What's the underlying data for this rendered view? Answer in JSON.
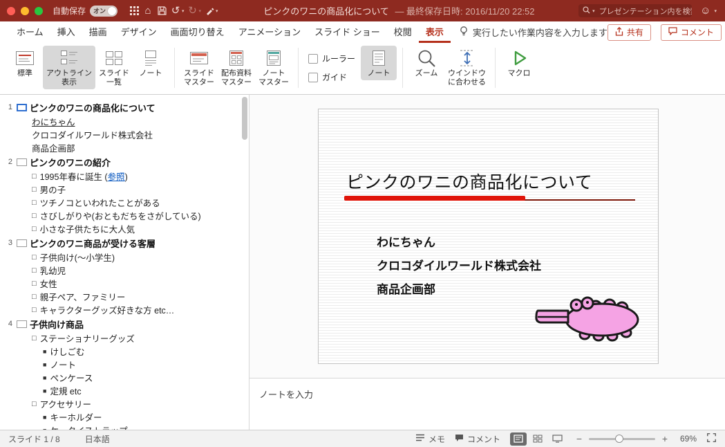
{
  "colors": {
    "titlebar": "#8e2a20",
    "accent": "#b5301c",
    "slide_underline_thick": "#e0150a",
    "slide_underline_thin": "#7c1508",
    "croc_pink": "#f5a3e4",
    "link": "#0a58c0"
  },
  "titlebar": {
    "autosave_label": "自動保存",
    "autosave_state": "オン",
    "doc_title": "ピンクのワニの商品化について",
    "save_status": "— 最終保存日時: 2016/11/20 22:52",
    "search_placeholder": "プレゼンテーション内を検索"
  },
  "ribbon": {
    "tabs": [
      "ホーム",
      "挿入",
      "描画",
      "デザイン",
      "画面切り替え",
      "アニメーション",
      "スライド ショー",
      "校閲",
      "表示"
    ],
    "active_tab": "表示",
    "tell_me": "実行したい作業内容を入力します",
    "share": "共有",
    "comments": "コメント",
    "buttons": {
      "normal": "標準",
      "outline_view": "アウトライン\n表示",
      "slide_sorter": "スライド\n一覧",
      "notes_page": "ノート",
      "slide_master": "スライド\nマスター",
      "handout_master": "配布資料\nマスター",
      "notes_master": "ノート\nマスター",
      "ruler": "ルーラー",
      "guides": "ガイド",
      "notes": "ノート",
      "zoom": "ズーム",
      "fit_window": "ウインドウ\nに合わせる",
      "macros": "マクロ"
    }
  },
  "outline": {
    "bullets": {
      "lvl1": "□",
      "lvl2": "■"
    },
    "slides": [
      {
        "num": "1",
        "selected": true,
        "title": "ピンクのワニの商品化について",
        "items": [
          {
            "lvl": 0,
            "text": "わにちゃん",
            "underline": true
          },
          {
            "lvl": 0,
            "text": "クロコダイルワールド株式会社"
          },
          {
            "lvl": 0,
            "text": "商品企画部"
          }
        ]
      },
      {
        "num": "2",
        "title": "ピンクのワニの紹介",
        "items": [
          {
            "lvl": 1,
            "pre": "1995年春に誕生 (",
            "link": "参照",
            "post": ")"
          },
          {
            "lvl": 1,
            "text": "男の子"
          },
          {
            "lvl": 1,
            "text": "ツチノコといわれたことがある"
          },
          {
            "lvl": 1,
            "text": "さびしがりや(おともだちをさがしている)"
          },
          {
            "lvl": 1,
            "text": "小さな子供たちに大人気"
          }
        ]
      },
      {
        "num": "3",
        "title": "ピンクのワニ商品が受ける客層",
        "items": [
          {
            "lvl": 1,
            "text": "子供向け(〜小学生)"
          },
          {
            "lvl": 1,
            "text": "乳幼児"
          },
          {
            "lvl": 1,
            "text": "女性"
          },
          {
            "lvl": 1,
            "text": "親子ペア、ファミリー"
          },
          {
            "lvl": 1,
            "text": "キャラクターグッズ好きな方 etc…"
          }
        ]
      },
      {
        "num": "4",
        "title": "子供向け商品",
        "items": [
          {
            "lvl": 1,
            "text": "ステーショナリーグッズ"
          },
          {
            "lvl": 2,
            "text": "けしごむ"
          },
          {
            "lvl": 2,
            "text": "ノート"
          },
          {
            "lvl": 2,
            "text": "ペンケース"
          },
          {
            "lvl": 2,
            "text": "定規 etc"
          },
          {
            "lvl": 1,
            "text": "アクセサリー"
          },
          {
            "lvl": 2,
            "text": "キーホルダー"
          },
          {
            "lvl": 2,
            "text": "ケータイストラップ"
          }
        ]
      }
    ]
  },
  "slide": {
    "title": "ピンクのワニの商品化について",
    "body_lines": [
      "わにちゃん",
      "クロコダイルワールド株式会社",
      "商品企画部"
    ]
  },
  "notes": {
    "placeholder": "ノートを入力"
  },
  "statusbar": {
    "slide_info": "スライド 1 / 8",
    "language": "日本語",
    "memo": "メモ",
    "comments": "コメント",
    "zoom": "69%"
  }
}
